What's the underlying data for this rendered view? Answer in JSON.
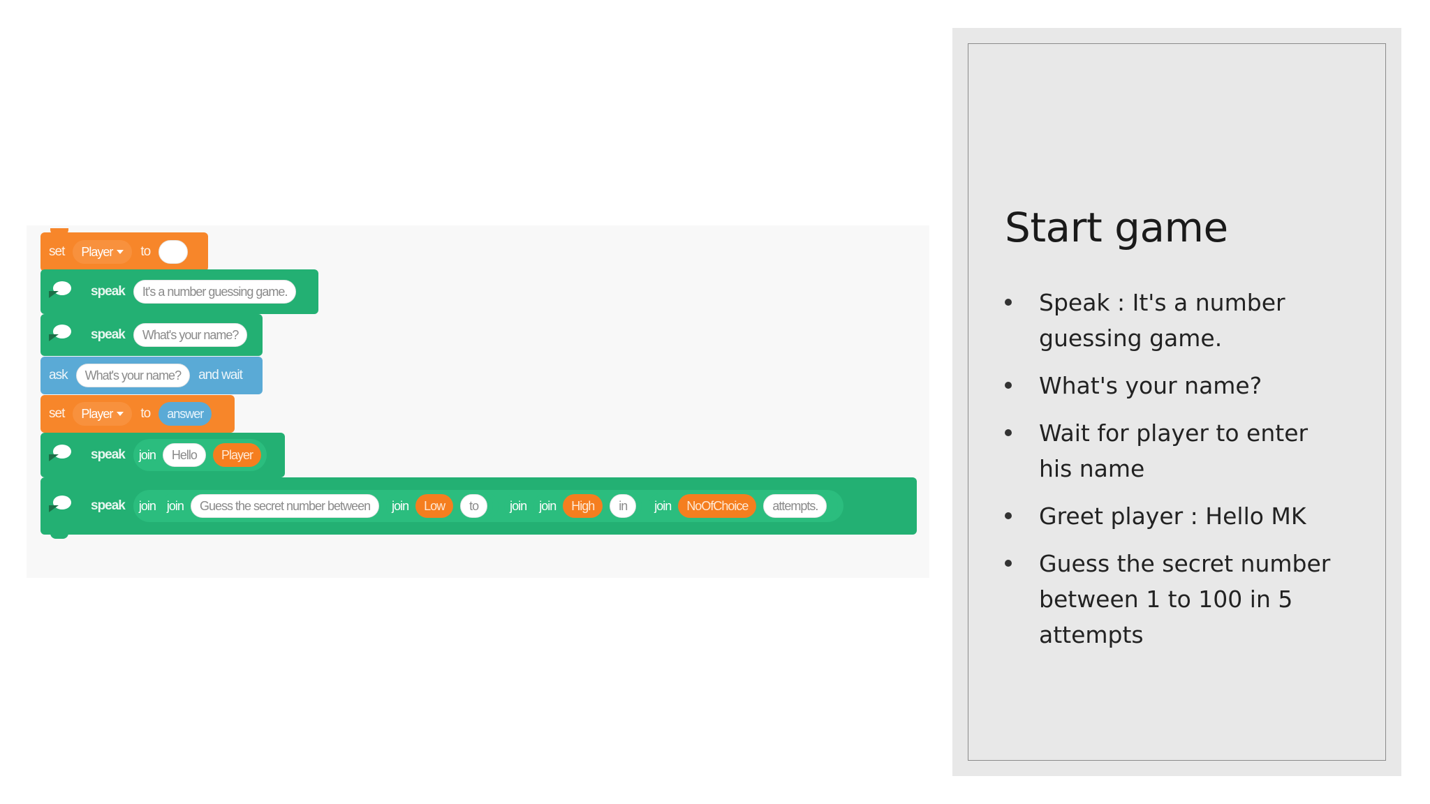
{
  "code": {
    "rows": [
      {
        "type": "set",
        "kw1": "set",
        "var": "Player",
        "kw2": "to",
        "value": ""
      },
      {
        "type": "speak",
        "kw": "speak",
        "text": "It's a number guessing game."
      },
      {
        "type": "speak",
        "kw": "speak",
        "text": "What's your name?"
      },
      {
        "type": "ask",
        "kw1": "ask",
        "text": "What's your name?",
        "kw2": "and wait"
      },
      {
        "type": "set",
        "kw1": "set",
        "var": "Player",
        "kw2": "to",
        "value": "answer"
      },
      {
        "type": "speak",
        "kw": "speak",
        "join": "join",
        "text": "Hello",
        "var": "Player"
      },
      {
        "type": "speak",
        "kw": "speak",
        "parts": [
          "join",
          "join",
          "Guess the secret number between",
          "join",
          "Low",
          "to",
          "join",
          "join",
          "High",
          "in",
          "join",
          "NoOfChoice",
          "attempts."
        ]
      }
    ]
  },
  "slide": {
    "title": "Start game",
    "bullets": [
      "Speak : It's a number guessing game.",
      "What's your name?",
      "Wait for player to enter his name",
      "Greet player : Hello MK",
      "Guess the secret number between 1 to 100 in 5 attempts"
    ]
  },
  "colors": {
    "looks_orange": "#f7862a",
    "speak_green": "#23b073",
    "sensing_blue": "#5aaad6",
    "panel_gray": "#e8e8e8"
  }
}
